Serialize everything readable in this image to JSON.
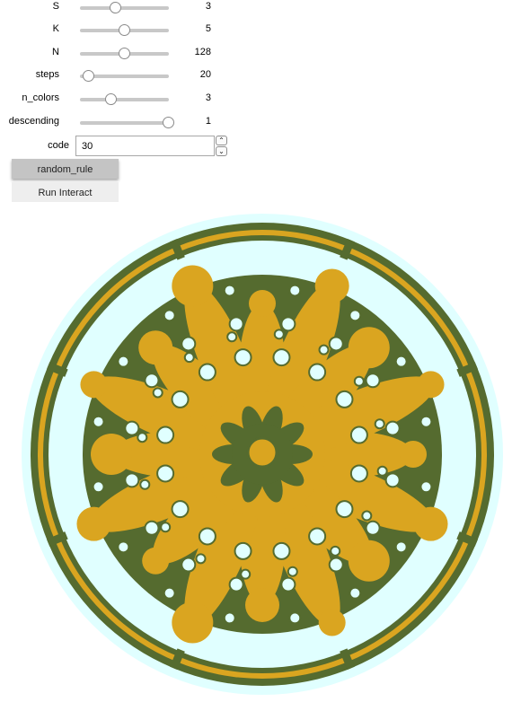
{
  "controls": {
    "sliders": [
      {
        "label": "S",
        "value": "3",
        "level": 0.4
      },
      {
        "label": "K",
        "value": "5",
        "level": 0.5
      },
      {
        "label": "N",
        "value": "128",
        "level": 0.5
      },
      {
        "label": "steps",
        "value": "20",
        "level": 0.1
      },
      {
        "label": "n_colors",
        "value": "3",
        "level": 0.35
      },
      {
        "label": "descending",
        "value": "1",
        "level": 1.0
      }
    ],
    "code": {
      "label": "code",
      "value": "30"
    },
    "random_rule_label": "random_rule",
    "run_label": "Run Interact"
  },
  "output": {
    "description_colors": {
      "dark_green": "#556b2f",
      "gold": "#daa520",
      "light_cyan": "#e0ffff"
    }
  }
}
